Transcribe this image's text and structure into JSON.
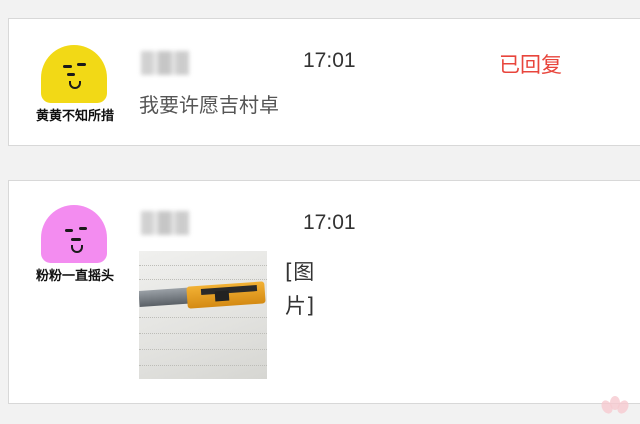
{
  "messages": [
    {
      "avatar_caption": "黄黄不知所措",
      "avatar_color": "#f2d916",
      "time": "17:01",
      "status": "已回复",
      "status_color": "#e8453c",
      "text": "我要许愿吉村卓"
    },
    {
      "avatar_caption": "粉粉一直摇头",
      "avatar_color": "#f38cf0",
      "time": "17:01",
      "image_label": "[图片]"
    }
  ]
}
